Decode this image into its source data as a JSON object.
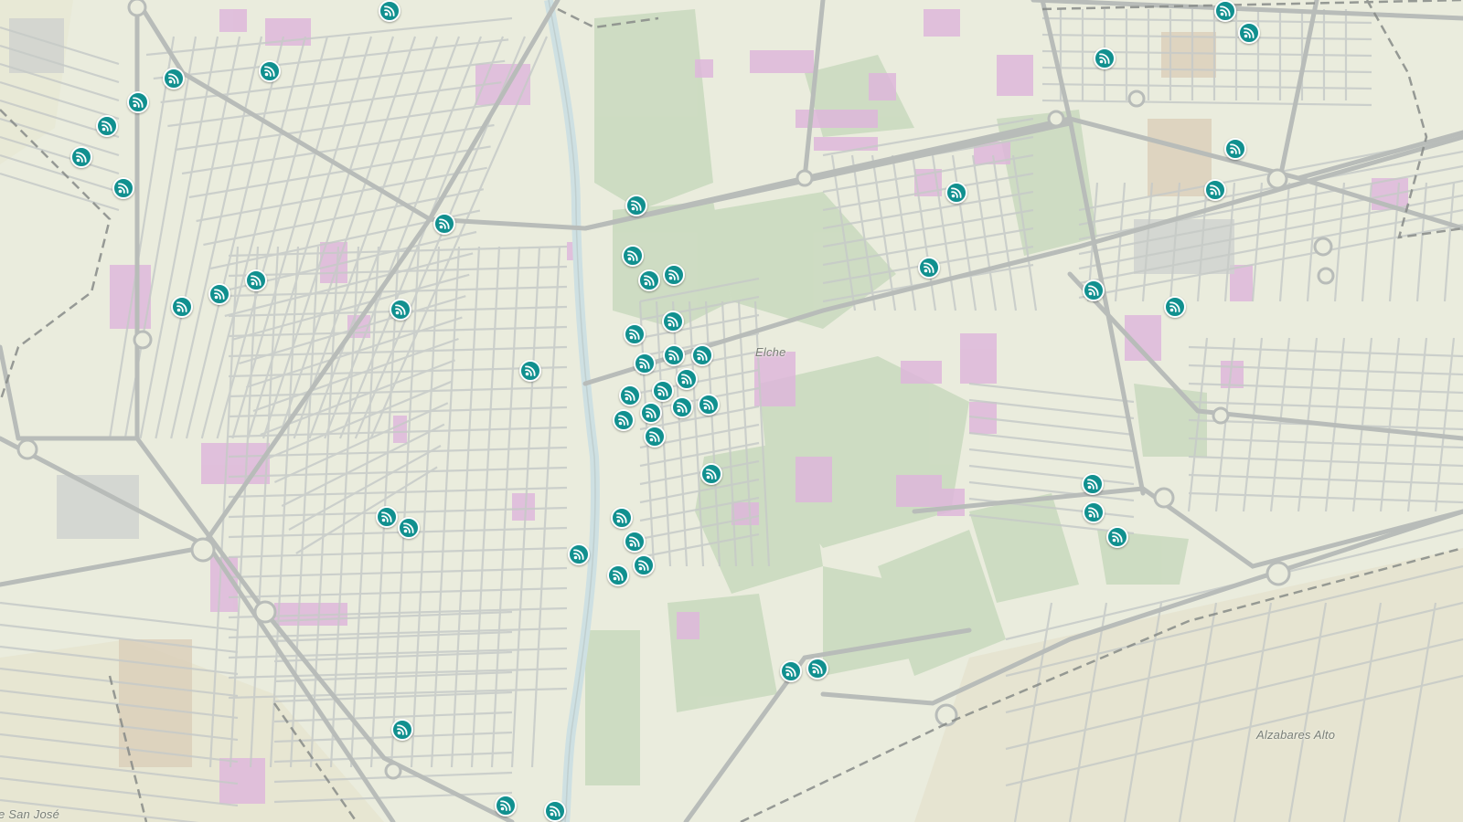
{
  "map": {
    "place_labels": {
      "city": "Elche",
      "south_east": "Alzabares Alto",
      "south_west": "e San José"
    },
    "marker_icon": "wifi-hotspot-icon",
    "marker_color": "#11908f",
    "colors": {
      "background": "#e9ebdc",
      "roads": "#b9bcbc",
      "parks": "#bdd3b3",
      "public_buildings": "#d9a3d8",
      "river": "#c8dde3"
    },
    "hotspot_count": 59
  }
}
